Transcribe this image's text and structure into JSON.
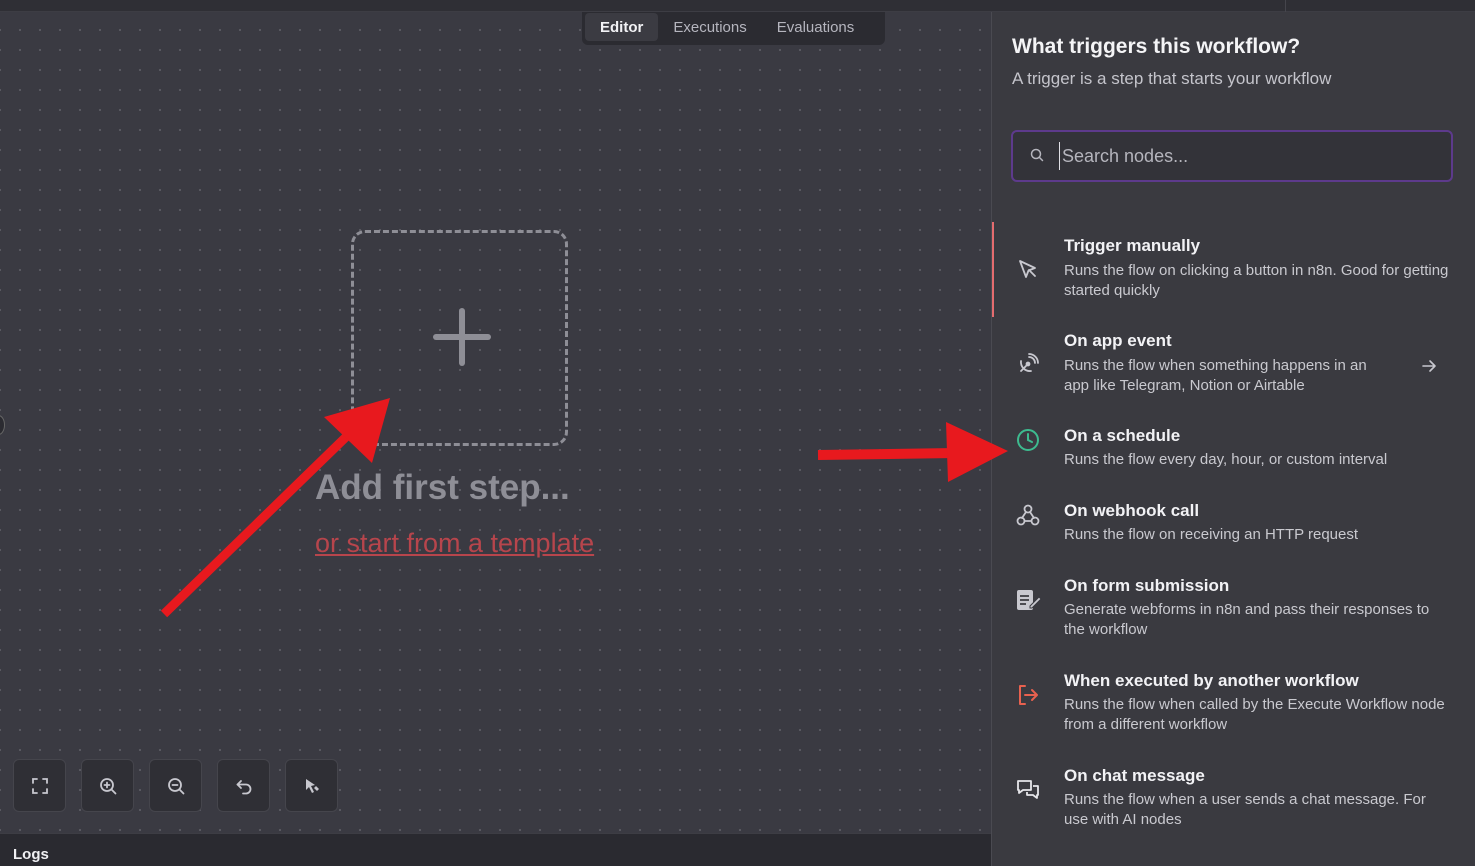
{
  "tabs": [
    {
      "label": "Editor",
      "active": true
    },
    {
      "label": "Executions",
      "active": false
    },
    {
      "label": "Evaluations",
      "active": false
    }
  ],
  "canvas": {
    "add_title": "Add first step...",
    "template_link": "or start from a template"
  },
  "controls": [
    {
      "icon": "fit-view-icon"
    },
    {
      "icon": "zoom-in-icon"
    },
    {
      "icon": "zoom-out-icon"
    },
    {
      "icon": "undo-icon"
    },
    {
      "icon": "tidy-up-icon"
    }
  ],
  "logs": {
    "label": "Logs"
  },
  "panel": {
    "title": "What triggers this workflow?",
    "subtitle": "A trigger is a step that starts your workflow",
    "search_placeholder": "Search nodes...",
    "items": [
      {
        "name": "Trigger manually",
        "desc": "Runs the flow on clicking a button in n8n. Good for getting started quickly",
        "icon": "cursor-icon",
        "selected": true
      },
      {
        "name": "On app event",
        "desc": "Runs the flow when something happens in an app like Telegram, Notion or Airtable",
        "icon": "satellite-dish-icon",
        "has_arrow": true
      },
      {
        "name": "On a schedule",
        "desc": "Runs the flow every day, hour, or custom interval",
        "icon": "clock-icon"
      },
      {
        "name": "On webhook call",
        "desc": "Runs the flow on receiving an HTTP request",
        "icon": "webhook-icon"
      },
      {
        "name": "On form submission",
        "desc": "Generate webforms in n8n and pass their responses to the workflow",
        "icon": "form-icon"
      },
      {
        "name": "When executed by another workflow",
        "desc": "Runs the flow when called by the Execute Workflow node from a different workflow",
        "icon": "sign-out-icon"
      },
      {
        "name": "On chat message",
        "desc": "Runs the flow when a user sends a chat message. For use with AI nodes",
        "icon": "chat-icon"
      }
    ]
  },
  "colors": {
    "selected_accent": "#e46c6f",
    "schedule_icon": "#3dbb8f",
    "exec_icon": "#e8614f",
    "annotation_arrow": "#e8191e"
  }
}
